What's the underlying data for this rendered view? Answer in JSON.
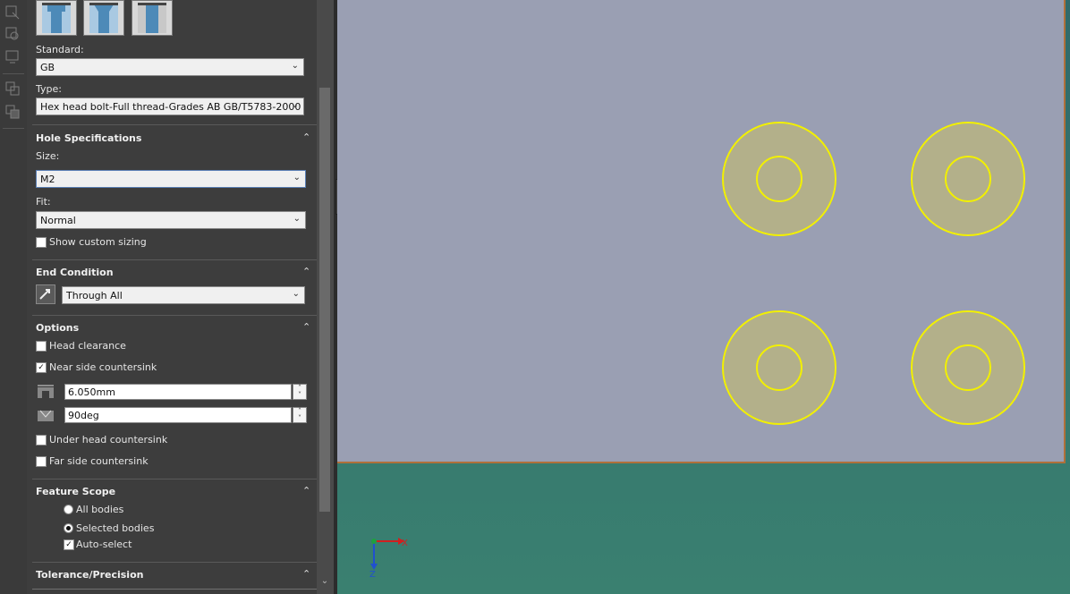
{
  "hole_type_buttons": [
    {
      "icon": "counterbore-icon"
    },
    {
      "icon": "countersink-icon"
    },
    {
      "icon": "straight-hole-icon"
    }
  ],
  "standard": {
    "label": "Standard:",
    "value": "GB"
  },
  "type": {
    "label": "Type:",
    "value": "Hex head bolt-Full thread-Grades AB GB/T5783-2000"
  },
  "hole_spec": {
    "title": "Hole Specifications",
    "size_label": "Size:",
    "size_value": "M2",
    "fit_label": "Fit:",
    "fit_value": "Normal",
    "custom_sizing": {
      "label": "Show custom sizing",
      "checked": false
    }
  },
  "end_condition": {
    "title": "End Condition",
    "value": "Through All"
  },
  "options": {
    "title": "Options",
    "head_clearance": {
      "label": "Head clearance",
      "checked": false
    },
    "near_side_countersink": {
      "label": "Near side countersink",
      "checked": true
    },
    "diameter": "6.050mm",
    "angle": "90deg",
    "under_head_countersink": {
      "label": "Under head countersink",
      "checked": false
    },
    "far_side_countersink": {
      "label": "Far side countersink",
      "checked": false
    }
  },
  "feature_scope": {
    "title": "Feature Scope",
    "all_bodies": "All bodies",
    "selected_bodies": "Selected bodies",
    "selected": "selected_bodies",
    "auto_select": {
      "label": "Auto-select",
      "checked": true
    }
  },
  "tolerance": {
    "title": "Tolerance/Precision"
  },
  "viewport": {
    "plane_color": "#9a9fb3",
    "hole_color": "#f2f000",
    "hole_fill": "#b3b08a",
    "triad": {
      "x": "X",
      "z": "Z"
    }
  }
}
